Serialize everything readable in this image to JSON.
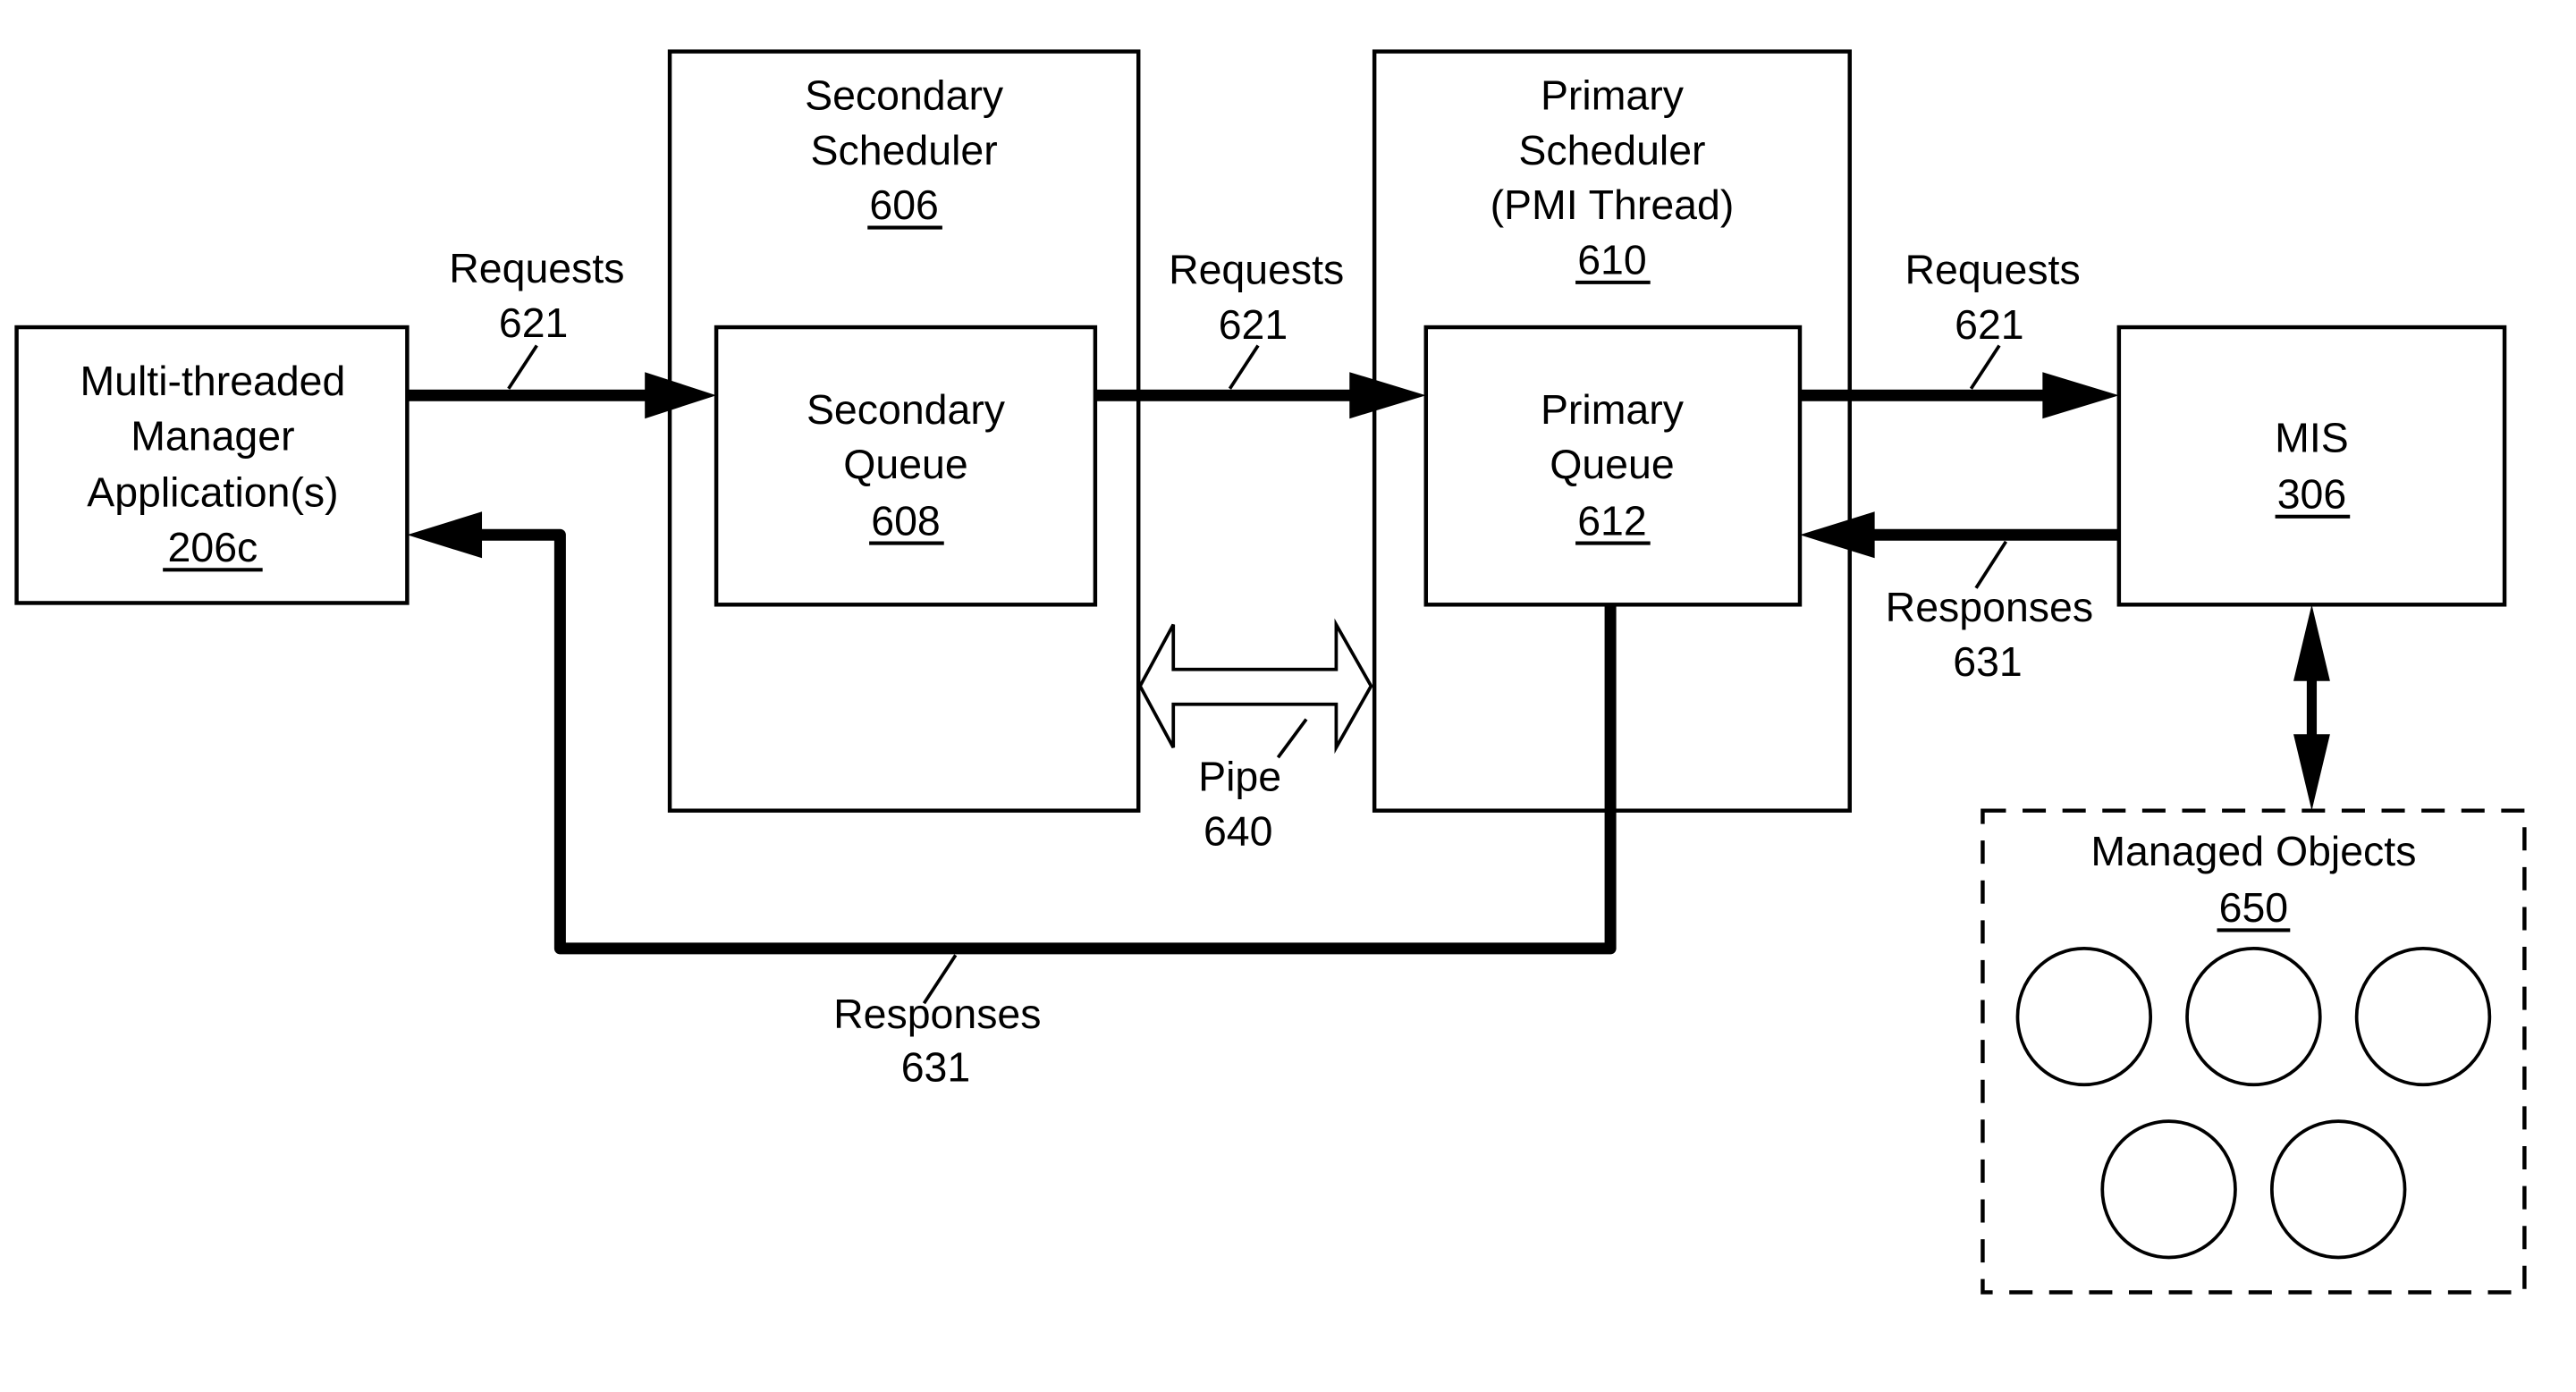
{
  "diagram": {
    "nodes": {
      "manager_app": {
        "lines": [
          "Multi-threaded",
          "Manager",
          "Application(s)"
        ],
        "ref": "206c"
      },
      "secondary_scheduler": {
        "lines": [
          "Secondary",
          "Scheduler"
        ],
        "ref": "606"
      },
      "secondary_queue": {
        "lines": [
          "Secondary",
          "Queue"
        ],
        "ref": "608"
      },
      "primary_scheduler": {
        "lines": [
          "Primary",
          "Scheduler",
          "(PMI Thread)"
        ],
        "ref": "610"
      },
      "primary_queue": {
        "lines": [
          "Primary",
          "Queue"
        ],
        "ref": "612"
      },
      "mis": {
        "lines": [
          "MIS"
        ],
        "ref": "306"
      },
      "managed_objects": {
        "lines": [
          "Managed Objects"
        ],
        "ref": "650",
        "object_count": 5
      }
    },
    "edges": {
      "requests_1": {
        "label": "Requests",
        "ref": "621",
        "from": "manager_app",
        "to": "secondary_queue"
      },
      "requests_2": {
        "label": "Requests",
        "ref": "621",
        "from": "secondary_queue",
        "to": "primary_queue"
      },
      "requests_3": {
        "label": "Requests",
        "ref": "621",
        "from": "primary_queue",
        "to": "mis"
      },
      "responses_1": {
        "label": "Responses",
        "ref": "631",
        "from": "mis",
        "to": "primary_queue"
      },
      "responses_2": {
        "label": "Responses",
        "ref": "631",
        "from": "primary_queue",
        "to": "manager_app"
      },
      "pipe": {
        "label": "Pipe",
        "ref": "640",
        "from": "secondary_scheduler",
        "to": "primary_scheduler",
        "bidirectional": true
      },
      "mis_objects": {
        "from": "mis",
        "to": "managed_objects",
        "bidirectional": true
      }
    }
  }
}
